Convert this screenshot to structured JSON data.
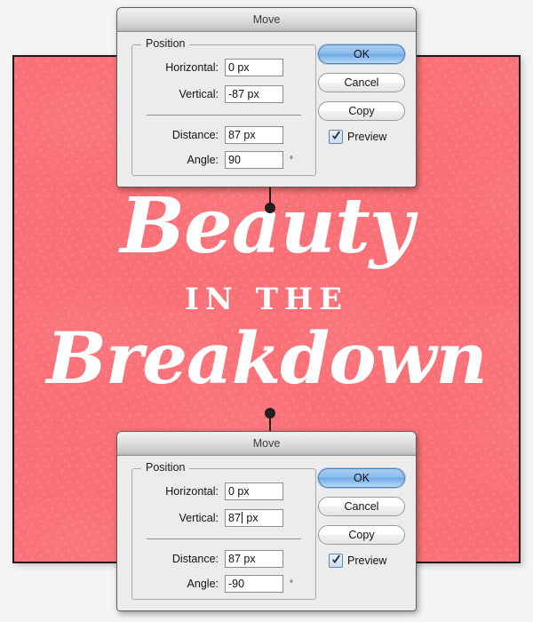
{
  "canvas": {
    "background_color": "#fa7077",
    "border_color": "#231815",
    "artwork": {
      "line1": "Beauty",
      "line2": "IN THE",
      "line3": "Breakdown",
      "text_color": "#ffffff"
    }
  },
  "pins": {
    "top": "pin-marker",
    "bottom": "pin-marker"
  },
  "dialogs": [
    {
      "id": "move-dialog-top",
      "title": "Move",
      "group_legend": "Position",
      "fields": [
        {
          "label": "Horizontal:",
          "value": "0 px"
        },
        {
          "label": "Vertical:",
          "value": "-87 px"
        },
        {
          "label": "Distance:",
          "value": "87 px"
        },
        {
          "label": "Angle:",
          "value": "90",
          "unit": "°"
        }
      ],
      "buttons": [
        {
          "label": "OK",
          "style": "default"
        },
        {
          "label": "Cancel",
          "style": "plain"
        },
        {
          "label": "Copy",
          "style": "plain"
        }
      ],
      "checkbox": {
        "label": "Preview",
        "checked": true
      }
    },
    {
      "id": "move-dialog-bottom",
      "title": "Move",
      "group_legend": "Position",
      "fields": [
        {
          "label": "Horizontal:",
          "value": "0 px"
        },
        {
          "label": "Vertical:",
          "value": "87 px",
          "caret_after": "87"
        },
        {
          "label": "Distance:",
          "value": "87 px"
        },
        {
          "label": "Angle:",
          "value": "-90",
          "unit": "°"
        }
      ],
      "buttons": [
        {
          "label": "OK",
          "style": "default"
        },
        {
          "label": "Cancel",
          "style": "plain"
        },
        {
          "label": "Copy",
          "style": "plain"
        }
      ],
      "checkbox": {
        "label": "Preview",
        "checked": true
      }
    }
  ]
}
